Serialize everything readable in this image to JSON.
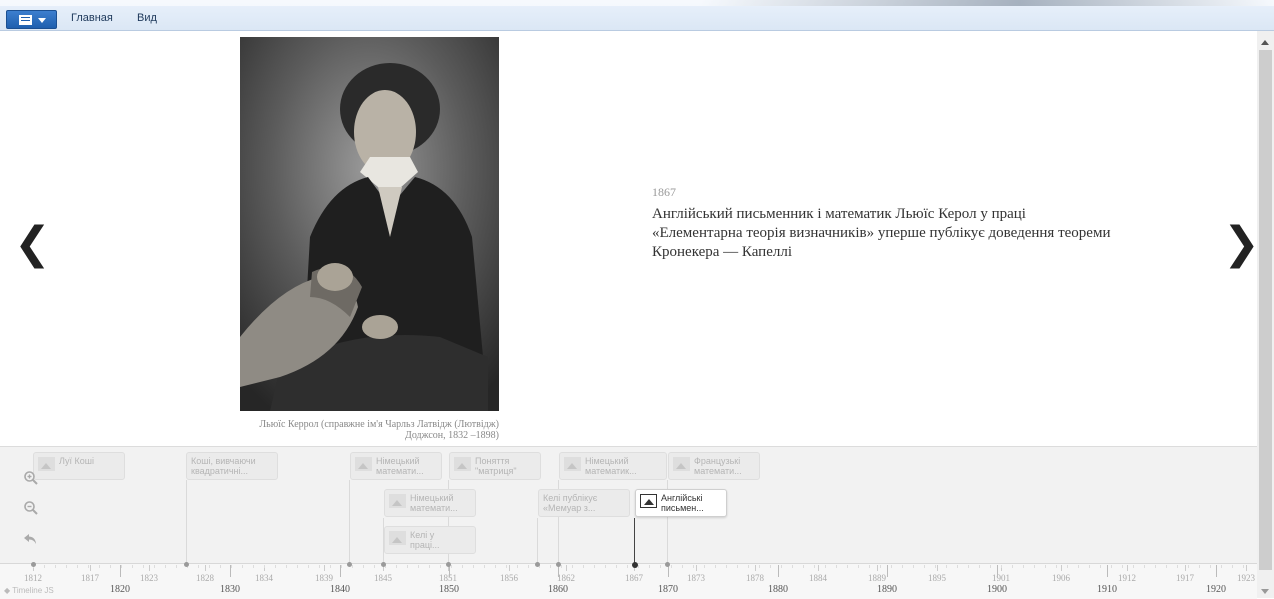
{
  "ribbon": {
    "tabs": [
      "Главная",
      "Вид"
    ]
  },
  "slide": {
    "date": "1867",
    "text": "Англійський письменник і математик Льюїс Керол у праці «Елементарна теорія визначників» уперше публікує доведення теореми Кронекера — Капеллі",
    "caption": "Льюїс Керрол (справжне ім'я Чарльз Латвідж (Лютвідж) Доджсон, 1832 –1898)"
  },
  "nav": {
    "prev_glyph": "❮",
    "next_glyph": "❯"
  },
  "tools": {
    "zoom_in_icon": "zoom-in-icon",
    "zoom_out_icon": "zoom-out-icon",
    "back_icon": "back-icon"
  },
  "markers": [
    {
      "text": [
        "Луї Коші"
      ],
      "has_media": true
    },
    {
      "text": [
        "Коші, вивчаючи",
        "квадратичні..."
      ],
      "has_media": false
    },
    {
      "text": [
        "Німецький",
        "математи..."
      ],
      "has_media": true
    },
    {
      "text": [
        "Поняття",
        "\"матриця\""
      ],
      "has_media": true
    },
    {
      "text": [
        "Німецький",
        "математик..."
      ],
      "has_media": true
    },
    {
      "text": [
        "Французькі",
        "математи..."
      ],
      "has_media": true
    },
    {
      "text": [
        "Німецький",
        "математи..."
      ],
      "has_media": true
    },
    {
      "text": [
        "Келі публікує",
        "«Мемуар з..."
      ],
      "has_media": false
    },
    {
      "text": [
        "Англійські",
        "письмен..."
      ],
      "has_media": true,
      "active": true
    },
    {
      "text": [
        "Келі у",
        "праці..."
      ],
      "has_media": true
    }
  ],
  "ruler": {
    "minor": [
      "1812",
      "1817",
      "1823",
      "1828",
      "1834",
      "1839",
      "1845",
      "1851",
      "1856",
      "1862",
      "1867",
      "1873",
      "1878",
      "1884",
      "1889",
      "1895",
      "1901",
      "1906",
      "1912",
      "1917",
      "1923"
    ],
    "major": [
      "1820",
      "1830",
      "1840",
      "1850",
      "1860",
      "1870",
      "1880",
      "1890",
      "1900",
      "1910",
      "1920"
    ]
  },
  "branding": "Timeline JS",
  "colors": {
    "ribbon_blue": "#2a6cc0",
    "active_marker_line": "#444444",
    "nav_bg": "#f2f2f2"
  }
}
